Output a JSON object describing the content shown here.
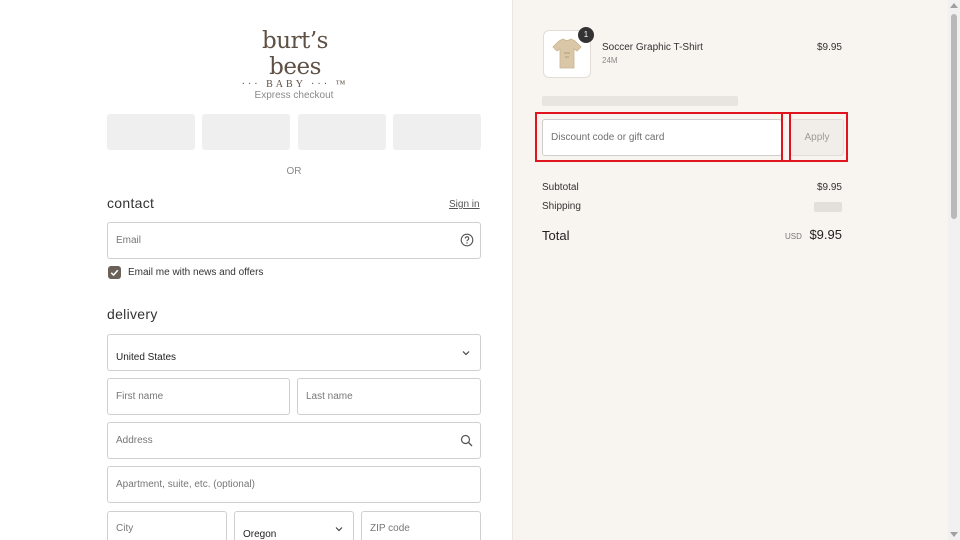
{
  "brand": {
    "name": "burt’s bees",
    "sub": "··· BABY ··· ™"
  },
  "express": {
    "label": "Express checkout",
    "or_label": "OR"
  },
  "contact": {
    "heading": "contact",
    "sign_in_label": "Sign in",
    "email_placeholder": "Email",
    "newsletter_label": "Email me with news and offers",
    "newsletter_checked": true
  },
  "delivery": {
    "heading": "delivery",
    "country_value": "United States",
    "first_name_placeholder": "First name",
    "last_name_placeholder": "Last name",
    "address_placeholder": "Address",
    "apartment_placeholder": "Apartment, suite, etc. (optional)",
    "city_placeholder": "City",
    "state_value": "Oregon",
    "zip_placeholder": "ZIP code"
  },
  "cart": {
    "items": [
      {
        "name": "Soccer Graphic T-Shirt",
        "variant": "24M",
        "price": "$9.95",
        "quantity": "1"
      }
    ]
  },
  "discount": {
    "placeholder": "Discount code or gift card",
    "apply_label": "Apply"
  },
  "summary": {
    "subtotal_label": "Subtotal",
    "subtotal_value": "$9.95",
    "shipping_label": "Shipping",
    "total_label": "Total",
    "total_currency": "USD",
    "total_value": "$9.95"
  },
  "colors": {
    "panel_bg": "#f8f4f0",
    "brand": "#5e5044",
    "highlight": "#e0141e"
  }
}
